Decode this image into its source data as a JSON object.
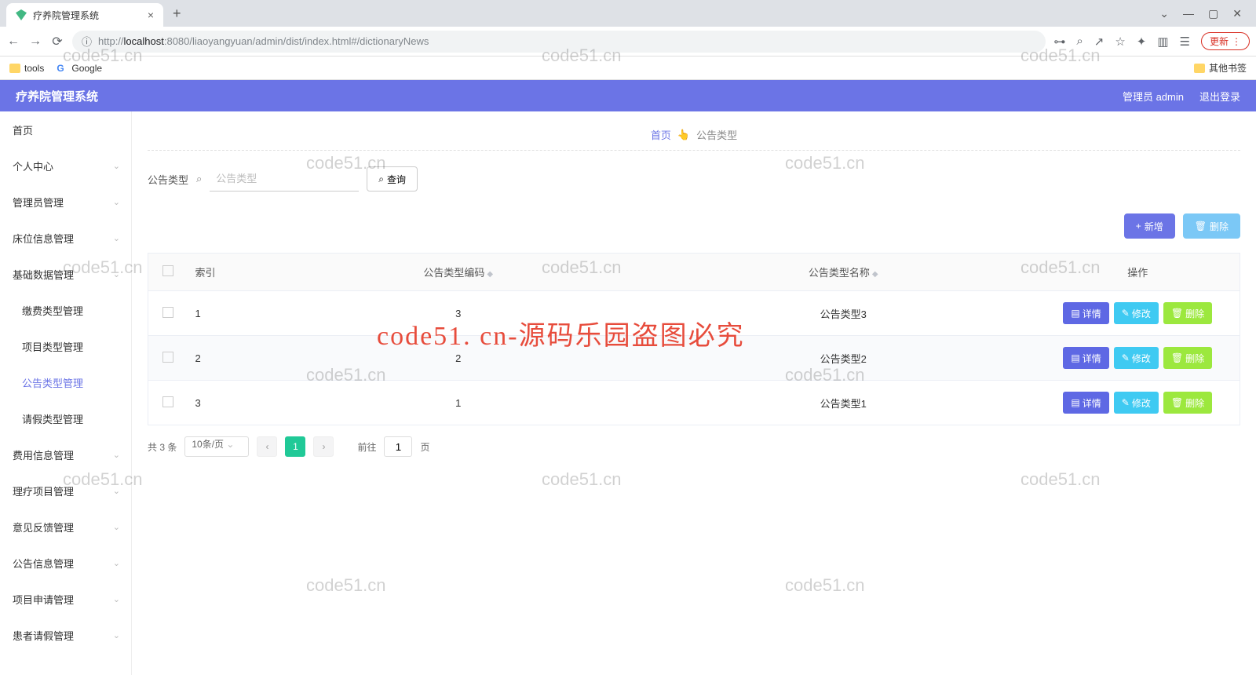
{
  "browser": {
    "tab_title": "疗养院管理系统",
    "url_prefix": "http://",
    "url_host": "localhost",
    "url_rest": ":8080/liaoyangyuan/admin/dist/index.html#/dictionaryNews",
    "bookmark_tools": "tools",
    "bookmark_google": "Google",
    "bookmark_other": "其他书签",
    "update_label": "更新"
  },
  "header": {
    "app_title": "疗养院管理系统",
    "user_role": "管理员 admin",
    "logout": "退出登录"
  },
  "sidebar": {
    "items": [
      {
        "label": "首页",
        "expandable": false
      },
      {
        "label": "个人中心",
        "expandable": true
      },
      {
        "label": "管理员管理",
        "expandable": true
      },
      {
        "label": "床位信息管理",
        "expandable": true
      },
      {
        "label": "基础数据管理",
        "expandable": true
      },
      {
        "label": "费用信息管理",
        "expandable": true
      },
      {
        "label": "理疗项目管理",
        "expandable": true
      },
      {
        "label": "意见反馈管理",
        "expandable": true
      },
      {
        "label": "公告信息管理",
        "expandable": true
      },
      {
        "label": "项目申请管理",
        "expandable": true
      },
      {
        "label": "患者请假管理",
        "expandable": true
      }
    ],
    "sub_items": [
      {
        "label": "缴费类型管理"
      },
      {
        "label": "项目类型管理"
      },
      {
        "label": "公告类型管理",
        "active": true
      },
      {
        "label": "请假类型管理"
      }
    ]
  },
  "breadcrumb": {
    "home": "首页",
    "hand": "👆",
    "current": "公告类型"
  },
  "search": {
    "label": "公告类型",
    "placeholder": "公告类型",
    "query_btn": "查询"
  },
  "actions": {
    "add": "新增",
    "delete": "删除"
  },
  "table": {
    "cols": {
      "index": "索引",
      "code": "公告类型编码",
      "name": "公告类型名称",
      "ops": "操作"
    },
    "row_ops": {
      "detail": "详情",
      "edit": "修改",
      "del": "删除"
    },
    "rows": [
      {
        "idx": "1",
        "code": "3",
        "name": "公告类型3"
      },
      {
        "idx": "2",
        "code": "2",
        "name": "公告类型2"
      },
      {
        "idx": "3",
        "code": "1",
        "name": "公告类型1"
      }
    ]
  },
  "pagination": {
    "total": "共 3 条",
    "page_size": "10条/页",
    "current": "1",
    "goto_prefix": "前往",
    "goto_value": "1",
    "goto_suffix": "页"
  },
  "watermarks": {
    "small": "code51.cn",
    "big": "code51. cn-源码乐园盗图必究"
  }
}
